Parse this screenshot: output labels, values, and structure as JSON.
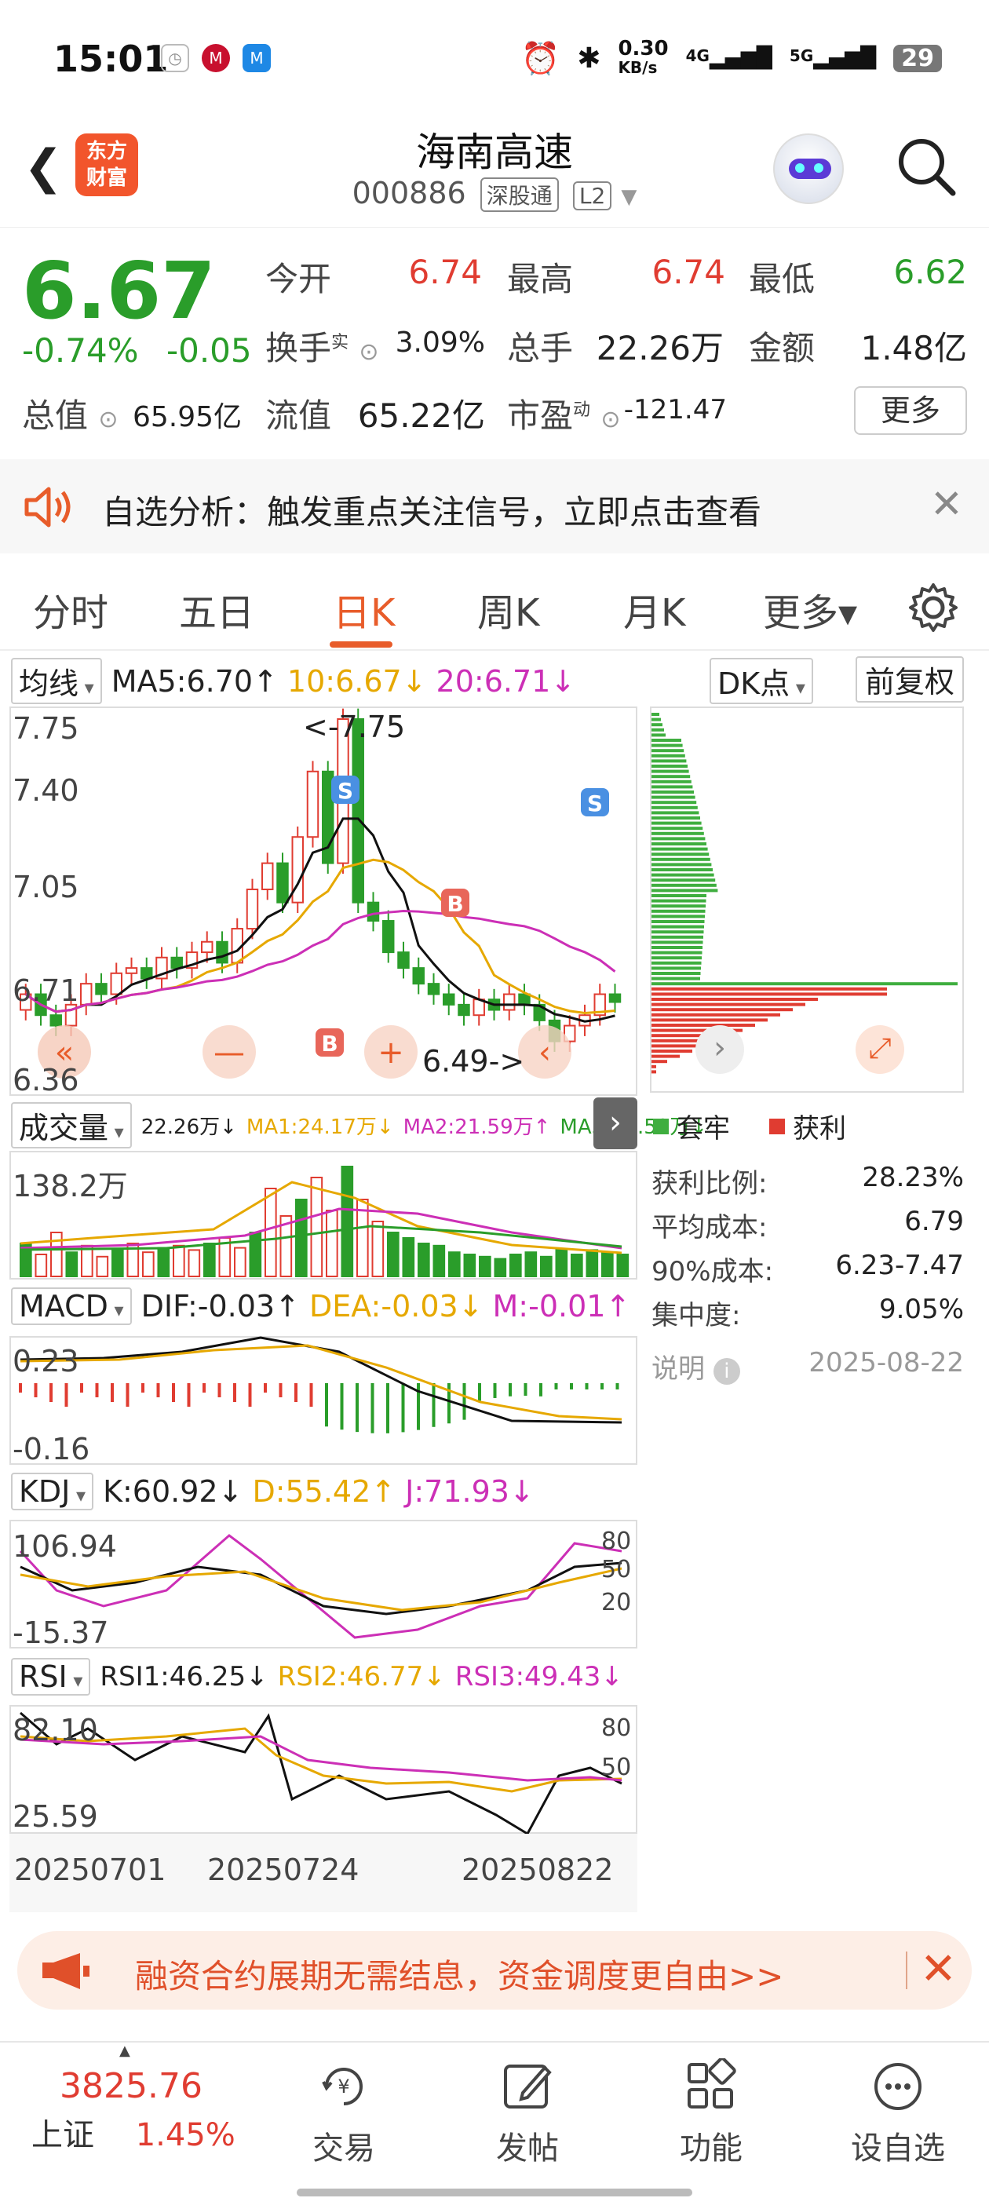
{
  "status_bar": {
    "time": "15:01",
    "net_speed": "0.30",
    "net_unit": "KB/s",
    "net_4g": "4G",
    "net_5g": "5G",
    "battery": "29"
  },
  "header": {
    "logo_line1": "东方",
    "logo_line2": "财富",
    "stock_name": "海南高速",
    "stock_code": "000886",
    "tag_connect": "深股通",
    "tag_level": "L2"
  },
  "quote": {
    "price": "6.67",
    "change_pct": "-0.74%",
    "change_abs": "-0.05",
    "open_label": "今开",
    "open_value": "6.74",
    "high_label": "最高",
    "high_value": "6.74",
    "low_label": "最低",
    "low_value": "6.62",
    "turnover_label": "换手",
    "turnover_sup": "实",
    "turnover_value": "3.09%",
    "volume_label": "总手",
    "volume_value": "22.26万",
    "amount_label": "金额",
    "amount_value": "1.48亿",
    "mktcap_label": "总值",
    "mktcap_value": "65.95亿",
    "float_label": "流值",
    "float_value": "65.22亿",
    "pe_label": "市盈",
    "pe_sup": "动",
    "pe_value": "-121.47",
    "more_label": "更多"
  },
  "alert": {
    "text": "自选分析：触发重点关注信号，立即点击查看",
    "close": "✕"
  },
  "tabs": [
    {
      "label": "分时"
    },
    {
      "label": "五日"
    },
    {
      "label": "日K"
    },
    {
      "label": "周K"
    },
    {
      "label": "月K"
    },
    {
      "label": "更多▾"
    }
  ],
  "indicators": {
    "ma_select": "均线",
    "ma5": "MA5:6.70↑",
    "ma10": "10:6.67↓",
    "ma20": "20:6.71↓",
    "dk_select": "DK点",
    "adjust": "前复权",
    "price_axis": [
      "7.75",
      "7.40",
      "7.05",
      "6.71",
      "6.36"
    ],
    "max_marker": "<-7.75",
    "min_marker": "6.49->",
    "vol_select": "成交量",
    "vol_text": "22.26万↓",
    "vol_ma1": "MA1:24.17万↓",
    "vol_ma2": "MA2:21.59万↑",
    "vol_ma3": "MA3:25.52万↓",
    "vol_axis_top": "138.2万",
    "macd_select": "MACD",
    "dif": "DIF:-0.03↑",
    "dea": "DEA:-0.03↓",
    "m": "M:-0.01↑",
    "macd_top": "0.23",
    "macd_bottom": "-0.16",
    "kdj_select": "KDJ",
    "k": "K:60.92↓",
    "d": "D:55.42↑",
    "j": "J:71.93↓",
    "kdj_top": "106.94",
    "kdj_bottom": "-15.37",
    "kdj_levels": [
      "80",
      "50",
      "20"
    ],
    "rsi_select": "RSI",
    "rsi1": "RSI1:46.25↓",
    "rsi2": "RSI2:46.77↓",
    "rsi3": "RSI3:49.43↓",
    "rsi_top": "82.10",
    "rsi_bottom": "25.59",
    "rsi_levels": [
      "80",
      "50"
    ],
    "dates": [
      "20250701",
      "20250724",
      "20250822"
    ],
    "signal_s": "S",
    "signal_b": "B"
  },
  "cost_panel": {
    "legend_trapped": "套牢",
    "legend_profit": "获利",
    "rows": [
      {
        "label": "获利比例:",
        "value": "28.23%"
      },
      {
        "label": "平均成本:",
        "value": "6.79"
      },
      {
        "label": "90%成本:",
        "value": "6.23-7.47"
      },
      {
        "label": "集中度:",
        "value": "9.05%"
      }
    ],
    "note_label": "说明",
    "date": "2025-08-22"
  },
  "promo": {
    "text": "融资合约展期无需结息，资金调度更自由>>"
  },
  "bottom_nav": {
    "index_value": "3825.76",
    "index_name": "上证",
    "index_change": "1.45%",
    "items": [
      {
        "label": "交易",
        "icon": "trade-icon"
      },
      {
        "label": "发帖",
        "icon": "post-icon"
      },
      {
        "label": "功能",
        "icon": "apps-icon"
      },
      {
        "label": "设自选",
        "icon": "more-dots-icon"
      }
    ]
  },
  "colors": {
    "up": "#e03c31",
    "down": "#2a9d2a",
    "accent": "#e85c2a",
    "gold": "#e6a800",
    "magenta": "#cc2fb6"
  }
}
